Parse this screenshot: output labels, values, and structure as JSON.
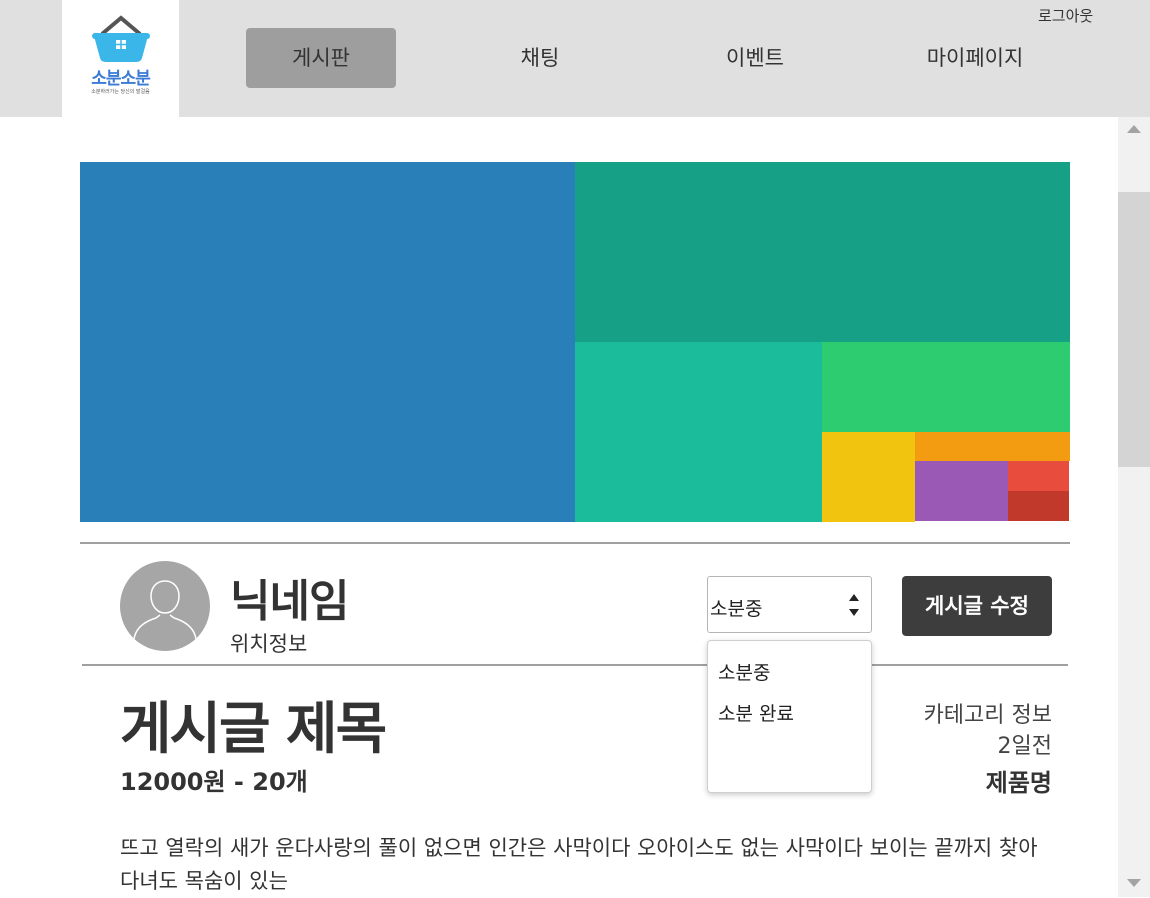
{
  "header": {
    "logo": {
      "name": "소분소분",
      "tagline": "소분하러가는 당신의 발걸음"
    },
    "nav": [
      {
        "label": "게시판",
        "active": true
      },
      {
        "label": "채팅",
        "active": false
      },
      {
        "label": "이벤트",
        "active": false
      },
      {
        "label": "마이페이지",
        "active": false
      }
    ],
    "logout_label": "로그아웃"
  },
  "banner": {
    "colors": [
      "#2980b9",
      "#16a085",
      "#1abc9c",
      "#2ecc71",
      "#f1c40f",
      "#f39c12",
      "#9b59b6",
      "#e74c3c",
      "#c0392b"
    ]
  },
  "author": {
    "nickname": "닉네임",
    "location": "위치정보"
  },
  "status_select": {
    "value": "소분중",
    "options": [
      "소분중",
      "소분 완료"
    ]
  },
  "edit_button_label": "게시글 수정",
  "post": {
    "title": "게시글 제목",
    "price_qty": "12000원 - 20개",
    "category": "카테고리 정보",
    "date": "2일전",
    "product": "제품명",
    "body": "뜨고 열락의 새가 운다사랑의 풀이 없으면 인간은 사막이다 오아이스도 없는 사막이다 보이는 끝까지 찾아다녀도 목숨이 있는"
  },
  "colors": {
    "header_bg": "#e0e0e0",
    "nav_active_bg": "#9e9e9e",
    "button_bg": "#3d3d3d",
    "logo_blue": "#3b7bd6"
  }
}
